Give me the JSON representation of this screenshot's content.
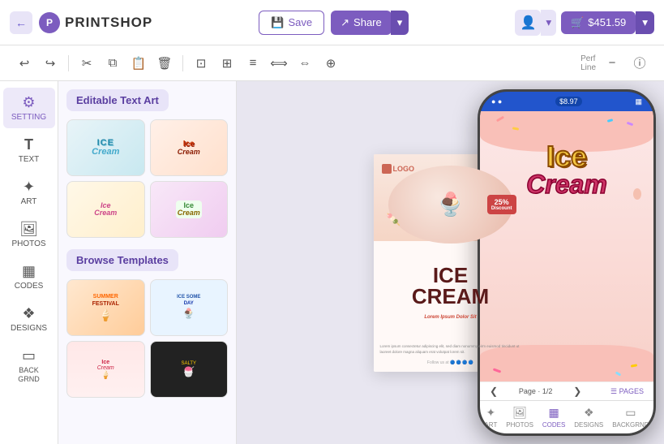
{
  "app": {
    "name": "PRINTSHOP"
  },
  "header": {
    "back_label": "←",
    "save_label": "Save",
    "share_label": "Share",
    "cart_price": "$451.59",
    "cart_label": "$451.59 ▾"
  },
  "toolbar": {
    "undo": "↩",
    "redo": "↪",
    "cut": "✂",
    "copy": "⧉",
    "paste": "📋",
    "delete": "🗑",
    "frame": "⊡",
    "group": "⊞",
    "align": "≡",
    "distribute": "⟺",
    "perf_line": "Perf\nLine"
  },
  "sidebar": {
    "items": [
      {
        "id": "setting",
        "label": "SETTING",
        "icon": "⚙"
      },
      {
        "id": "text",
        "label": "TEXT",
        "icon": "T"
      },
      {
        "id": "art",
        "label": "ART",
        "icon": "✦"
      },
      {
        "id": "photos",
        "label": "PHOTOS",
        "icon": "🖼"
      },
      {
        "id": "codes",
        "label": "CODES",
        "icon": "▦"
      },
      {
        "id": "designs",
        "label": "DESIGNS",
        "icon": "❖"
      },
      {
        "id": "background",
        "label": "BACKGROUND\nND",
        "icon": "▭"
      }
    ]
  },
  "panel": {
    "text_art_title": "Editable Text Art",
    "browse_templates_title": "Browse Templates",
    "thumbnails": [
      {
        "id": "t1",
        "label": "ICE CREAM style 1"
      },
      {
        "id": "t2",
        "label": "ICE CREAM style 2"
      },
      {
        "id": "t3",
        "label": "ICE CREAM style 3"
      },
      {
        "id": "t4",
        "label": "ICE CREAM style 4"
      },
      {
        "id": "t5",
        "label": "SUMMER FESTIVAL"
      },
      {
        "id": "t6",
        "label": "ICE SOME DAY"
      },
      {
        "id": "t7",
        "label": "Ice Cream browse"
      },
      {
        "id": "t8",
        "label": "SALTY"
      }
    ]
  },
  "canvas": {
    "doc_logo": "LOGO",
    "doc_discount": "25%\nDiscount",
    "doc_title_line1": "ICE",
    "doc_title_line2": "CREAM",
    "doc_subtitle": "Lorem Ipsum Dolor Sit",
    "doc_lorem": "Lorem ipsum consectetur adipiscing elit, sed diam nonummy eirm euismod tincidunt ut laoreet dolore magna aliquam erat volutpat lorem sit.",
    "doc_follow": "Follow us at 🔵 🔵 🔵 🔵"
  },
  "phone": {
    "status_left": "●",
    "status_right": "▦",
    "price": "$8.97",
    "ice_text": "Ice",
    "cream_text": "Cream",
    "nav_page": "Page · 1/2",
    "nav_pages": "☰ PAGES",
    "toolbar": [
      {
        "id": "art",
        "label": "ART",
        "icon": "✦",
        "active": false
      },
      {
        "id": "photos",
        "label": "PHOTOS",
        "icon": "🖼",
        "active": false
      },
      {
        "id": "codes",
        "label": "CODES",
        "icon": "▦",
        "active": true
      },
      {
        "id": "designs",
        "label": "DESIGNS",
        "icon": "❖",
        "active": false
      },
      {
        "id": "background",
        "label": "BACKGRND",
        "icon": "▭",
        "active": false
      }
    ]
  }
}
